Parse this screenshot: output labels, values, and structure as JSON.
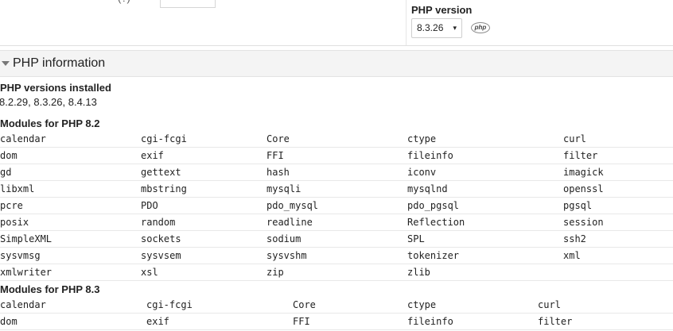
{
  "top": {
    "partial_label": "(?)",
    "php_version_label": "PHP version",
    "php_version_selected": "8.3.26",
    "php_logo_text": "php",
    "select_arrow": "▾"
  },
  "section": {
    "title": "PHP information",
    "installed_heading": "PHP versions installed",
    "installed_versions": "8.2.29, 8.3.26, 8.4.13"
  },
  "modules_82": {
    "heading": "Modules for PHP 8.2",
    "rows": [
      [
        "calendar",
        "cgi-fcgi",
        "Core",
        "ctype",
        "curl"
      ],
      [
        "dom",
        "exif",
        "FFI",
        "fileinfo",
        "filter"
      ],
      [
        "gd",
        "gettext",
        "hash",
        "iconv",
        "imagick"
      ],
      [
        "libxml",
        "mbstring",
        "mysqli",
        "mysqlnd",
        "openssl"
      ],
      [
        "pcre",
        "PDO",
        "pdo_mysql",
        "pdo_pgsql",
        "pgsql"
      ],
      [
        "posix",
        "random",
        "readline",
        "Reflection",
        "session"
      ],
      [
        "SimpleXML",
        "sockets",
        "sodium",
        "SPL",
        "ssh2"
      ],
      [
        "sysvmsg",
        "sysvsem",
        "sysvshm",
        "tokenizer",
        "xml"
      ],
      [
        "xmlwriter",
        "xsl",
        "zip",
        "zlib",
        ""
      ]
    ]
  },
  "modules_83": {
    "heading": "Modules for PHP 8.3",
    "rows": [
      [
        "calendar",
        "cgi-fcgi",
        "Core",
        "ctype",
        "curl"
      ],
      [
        "dom",
        "exif",
        "FFI",
        "fileinfo",
        "filter"
      ]
    ]
  }
}
